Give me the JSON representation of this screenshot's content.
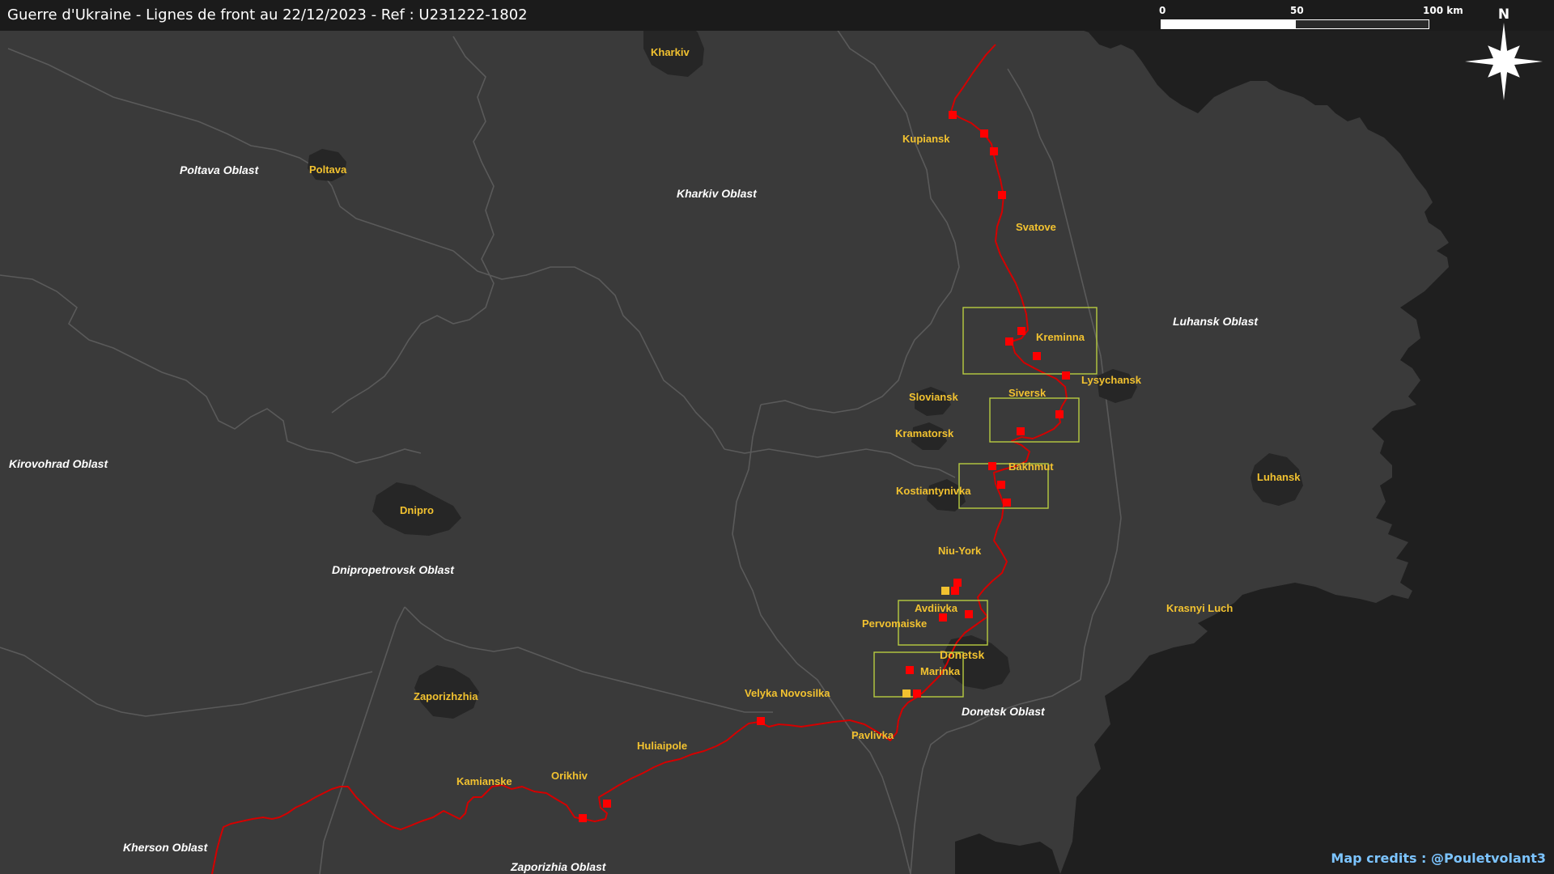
{
  "title": "Guerre d'Ukraine - Lignes de front au 22/12/2023 - Ref : U231222-1802",
  "scale_bar": {
    "ticks": [
      "0",
      "50",
      "100 km"
    ]
  },
  "north_arrow": {
    "label": "N",
    "icon": "compass-star-icon"
  },
  "credits": "Map credits : @Pouletvolant3",
  "colors": {
    "background_land": "#3a3a3a",
    "occupied_territory": "#1f1f1f",
    "border": "#5a5a5a",
    "urban_area": "#262626",
    "front_line": "#d40000",
    "marker_red": "#ff0000",
    "marker_yellow": "#f2c230",
    "zoom_box": "#b8cc40",
    "city_label": "#f2c230",
    "oblast_label": "#ffffff"
  },
  "oblasts": [
    {
      "name": "Poltava Oblast"
    },
    {
      "name": "Kharkiv Oblast"
    },
    {
      "name": "Luhansk Oblast"
    },
    {
      "name": "Kirovohrad Oblast"
    },
    {
      "name": "Dnipropetrovsk Oblast"
    },
    {
      "name": "Donetsk Oblast"
    },
    {
      "name": "Kherson Oblast"
    },
    {
      "name": "Zaporizhia Oblast"
    }
  ],
  "cities": [
    {
      "name": "Kharkiv"
    },
    {
      "name": "Poltava"
    },
    {
      "name": "Kupiansk"
    },
    {
      "name": "Svatove"
    },
    {
      "name": "Kreminna"
    },
    {
      "name": "Lysychansk"
    },
    {
      "name": "Siversk"
    },
    {
      "name": "Sloviansk"
    },
    {
      "name": "Kramatorsk"
    },
    {
      "name": "Bakhmut"
    },
    {
      "name": "Kostiantynivka"
    },
    {
      "name": "Luhansk"
    },
    {
      "name": "Dnipro"
    },
    {
      "name": "Niu-York"
    },
    {
      "name": "Avdiivka"
    },
    {
      "name": "Pervomaiske"
    },
    {
      "name": "Donetsk"
    },
    {
      "name": "Marinka"
    },
    {
      "name": "Krasnyi Luch"
    },
    {
      "name": "Velyka Novosilka"
    },
    {
      "name": "Zaporizhzhia"
    },
    {
      "name": "Huliaipole"
    },
    {
      "name": "Pavlivka"
    },
    {
      "name": "Orikhiv"
    },
    {
      "name": "Kamianske"
    }
  ],
  "zoom_boxes": [
    "Kreminna",
    "Siversk",
    "Bakhmut",
    "Avdiivka",
    "Marinka"
  ],
  "markers": [
    {
      "color": "red"
    },
    {
      "color": "red"
    },
    {
      "color": "red"
    },
    {
      "color": "red"
    },
    {
      "color": "red"
    },
    {
      "color": "red"
    },
    {
      "color": "red"
    },
    {
      "color": "red"
    },
    {
      "color": "red"
    },
    {
      "color": "red"
    },
    {
      "color": "red"
    },
    {
      "color": "red"
    },
    {
      "color": "red"
    },
    {
      "color": "red"
    },
    {
      "color": "red"
    },
    {
      "color": "yellow"
    },
    {
      "color": "red"
    },
    {
      "color": "red"
    },
    {
      "color": "red"
    },
    {
      "color": "yellow"
    },
    {
      "color": "red"
    },
    {
      "color": "red"
    },
    {
      "color": "red"
    },
    {
      "color": "red"
    }
  ]
}
